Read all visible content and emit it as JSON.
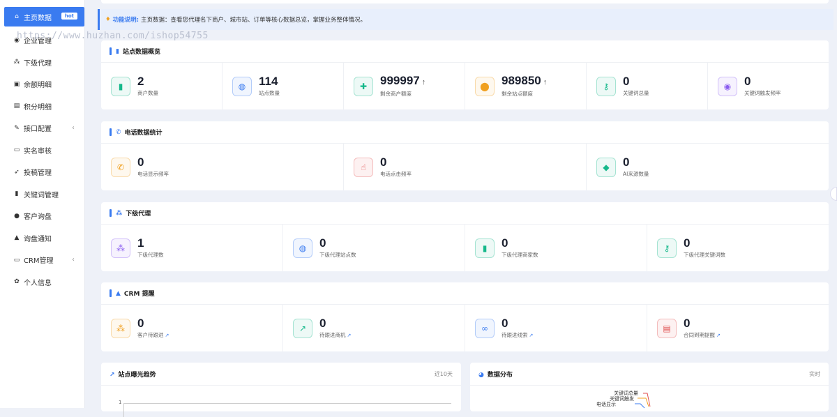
{
  "sidebar": {
    "items": [
      {
        "label": "主页数据",
        "icon": "home-icon",
        "glyph": "⌂",
        "badge": "hot",
        "active": true
      },
      {
        "label": "企业管理",
        "icon": "building-icon",
        "glyph": "◉"
      },
      {
        "label": "下级代理",
        "icon": "sitemap-icon",
        "glyph": "⁂"
      },
      {
        "label": "余额明细",
        "icon": "wallet-icon",
        "glyph": "▣"
      },
      {
        "label": "积分明细",
        "icon": "list-icon",
        "glyph": "▤"
      },
      {
        "label": "接口配置",
        "icon": "plug-icon",
        "glyph": "✎",
        "chevron": "‹"
      },
      {
        "label": "实名审核",
        "icon": "id-card-icon",
        "glyph": "▭"
      },
      {
        "label": "投稿管理",
        "icon": "send-icon",
        "glyph": "➶"
      },
      {
        "label": "关键词管理",
        "icon": "book-icon",
        "glyph": "▮"
      },
      {
        "label": "客户询盘",
        "icon": "chat-icon",
        "glyph": "●"
      },
      {
        "label": "询盘通知",
        "icon": "bell-icon",
        "glyph": "▲"
      },
      {
        "label": "CRM管理",
        "icon": "address-card-icon",
        "glyph": "▭",
        "chevron": "‹"
      },
      {
        "label": "个人信息",
        "icon": "gear-icon",
        "glyph": "✿"
      }
    ]
  },
  "watermark": "https://www.huzhan.com/ishop54755",
  "notice": {
    "label": "功能说明:",
    "text": "主页数据：查看您代理名下商户、城市站、订单等核心数据总览，掌握业务整体情况。"
  },
  "sections": {
    "site": {
      "title": "站点数据概览",
      "stats": [
        {
          "value": "2",
          "label": "商户数量",
          "icon": "mobile-icon",
          "glyph": "▮",
          "color": "#14b88a"
        },
        {
          "value": "114",
          "label": "站点数量",
          "icon": "globe-icon",
          "glyph": "◍",
          "color": "#3a7bf0"
        },
        {
          "value": "999997",
          "label": "剩余商户额度",
          "up": "↑",
          "icon": "user-plus-icon",
          "glyph": "✚",
          "color": "#14b88a"
        },
        {
          "value": "989850",
          "label": "剩余站点额度",
          "up": "↑",
          "icon": "map-pin-icon",
          "glyph": "⬤",
          "color": "#f0a020"
        },
        {
          "value": "0",
          "label": "关键词总量",
          "icon": "key-icon",
          "glyph": "⚷",
          "color": "#14b88a"
        },
        {
          "value": "0",
          "label": "关键词触发频率",
          "icon": "eye-icon",
          "glyph": "◉",
          "color": "#8a5cf0"
        }
      ]
    },
    "phone": {
      "title": "电话数据统计",
      "stats": [
        {
          "value": "0",
          "label": "电话显示频率",
          "icon": "phone-icon",
          "glyph": "✆",
          "color": "#f0a020"
        },
        {
          "value": "0",
          "label": "电话点击频率",
          "icon": "hand-pointer-icon",
          "glyph": "☝",
          "color": "#e05050"
        },
        {
          "value": "0",
          "label": "AI来源数量",
          "icon": "android-icon",
          "glyph": "◆",
          "color": "#14b88a"
        }
      ]
    },
    "agent": {
      "title": "下级代理",
      "stats": [
        {
          "value": "1",
          "label": "下级代理数",
          "icon": "users-icon",
          "glyph": "⁂",
          "color": "#8a5cf0"
        },
        {
          "value": "0",
          "label": "下级代理站点数",
          "icon": "globe-icon",
          "glyph": "◍",
          "color": "#3a7bf0"
        },
        {
          "value": "0",
          "label": "下级代理商家数",
          "icon": "mobile-icon",
          "glyph": "▮",
          "color": "#14b88a"
        },
        {
          "value": "0",
          "label": "下级代理关键词数",
          "icon": "key-icon",
          "glyph": "⚷",
          "color": "#14b88a"
        }
      ]
    },
    "crm": {
      "title": "CRM 提醒",
      "stats": [
        {
          "value": "0",
          "label": "客户待跟进",
          "link": "↗",
          "icon": "users-icon",
          "glyph": "⁂",
          "color": "#f0a020"
        },
        {
          "value": "0",
          "label": "待跟进商机",
          "link": "↗",
          "icon": "chart-line-icon",
          "glyph": "↗",
          "color": "#14b88a"
        },
        {
          "value": "0",
          "label": "待跟进线索",
          "link": "↗",
          "icon": "link-icon",
          "glyph": "∞",
          "color": "#3a7bf0"
        },
        {
          "value": "0",
          "label": "合同到期提醒",
          "link": "↗",
          "icon": "file-icon",
          "glyph": "▤",
          "color": "#e05050"
        }
      ]
    }
  },
  "trend": {
    "title": "站点曝光趋势",
    "range": "近10天",
    "axis_tick": "1"
  },
  "dist": {
    "title": "数据分布",
    "mode": "实时",
    "labels": [
      "关键词总量",
      "关键词触发",
      "电话显示"
    ]
  },
  "colors": {
    "accent": "#3a7bf0",
    "sidebar_active": "#3a7bf0",
    "page_bg": "#eef1f8"
  }
}
